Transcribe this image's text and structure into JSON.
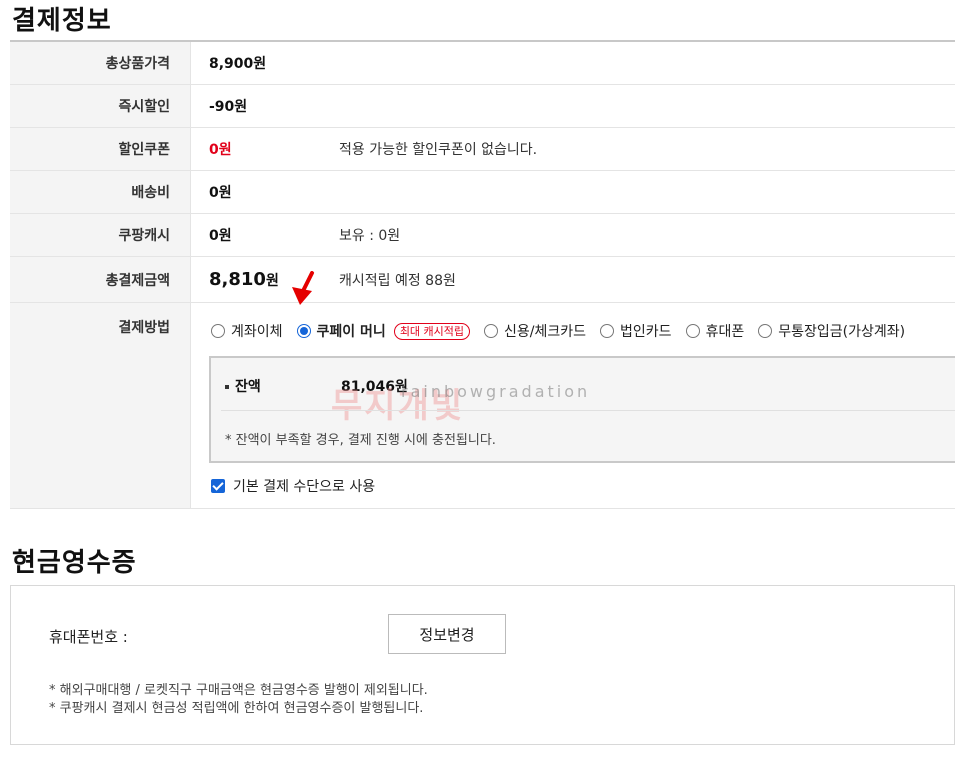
{
  "payment": {
    "title": "결제정보",
    "rows": [
      {
        "label": "총상품가격",
        "amount": "8,900원",
        "note": ""
      },
      {
        "label": "즉시할인",
        "amount": "-90원",
        "note": ""
      },
      {
        "label": "할인쿠폰",
        "amount": "0원",
        "note": "적용 가능한 할인쿠폰이 없습니다."
      },
      {
        "label": "배송비",
        "amount": "0원",
        "note": ""
      },
      {
        "label": "쿠팡캐시",
        "amount": "0원",
        "note": "보유 : 0원"
      },
      {
        "label": "총결제금액",
        "amount": "8,810",
        "amount_unit": "원",
        "note": "캐시적립 예정 88원"
      }
    ],
    "method_label": "결제방법",
    "methods": [
      {
        "label": "계좌이체",
        "selected": false
      },
      {
        "label": "쿠페이 머니",
        "selected": true,
        "badge": "최대 캐시적립"
      },
      {
        "label": "신용/체크카드",
        "selected": false
      },
      {
        "label": "법인카드",
        "selected": false
      },
      {
        "label": "휴대폰",
        "selected": false
      },
      {
        "label": "무통장입금(가상계좌)",
        "selected": false
      }
    ],
    "balance_label": "잔액",
    "balance_value": "81,046원",
    "balance_notice": "* 잔액이 부족할 경우, 결제 진행 시에 충전됩니다.",
    "default_checkbox_label": "기본 결제 수단으로 사용",
    "default_checked": true,
    "watermark_text": "무지개빛",
    "watermark_sub": "rainbowgradation"
  },
  "receipt": {
    "title": "현금영수증",
    "phone_label": "휴대폰번호 :",
    "change_button": "정보변경",
    "notes": [
      "* 해외구매대행 / 로켓직구 구매금액은 현금영수증 발행이 제외됩니다.",
      "* 쿠팡캐시 결제시 현금성 적립액에 한하여 현금영수증이 발행됩니다."
    ]
  },
  "colors": {
    "accent": "#1565d8",
    "red": "#e1001a"
  }
}
